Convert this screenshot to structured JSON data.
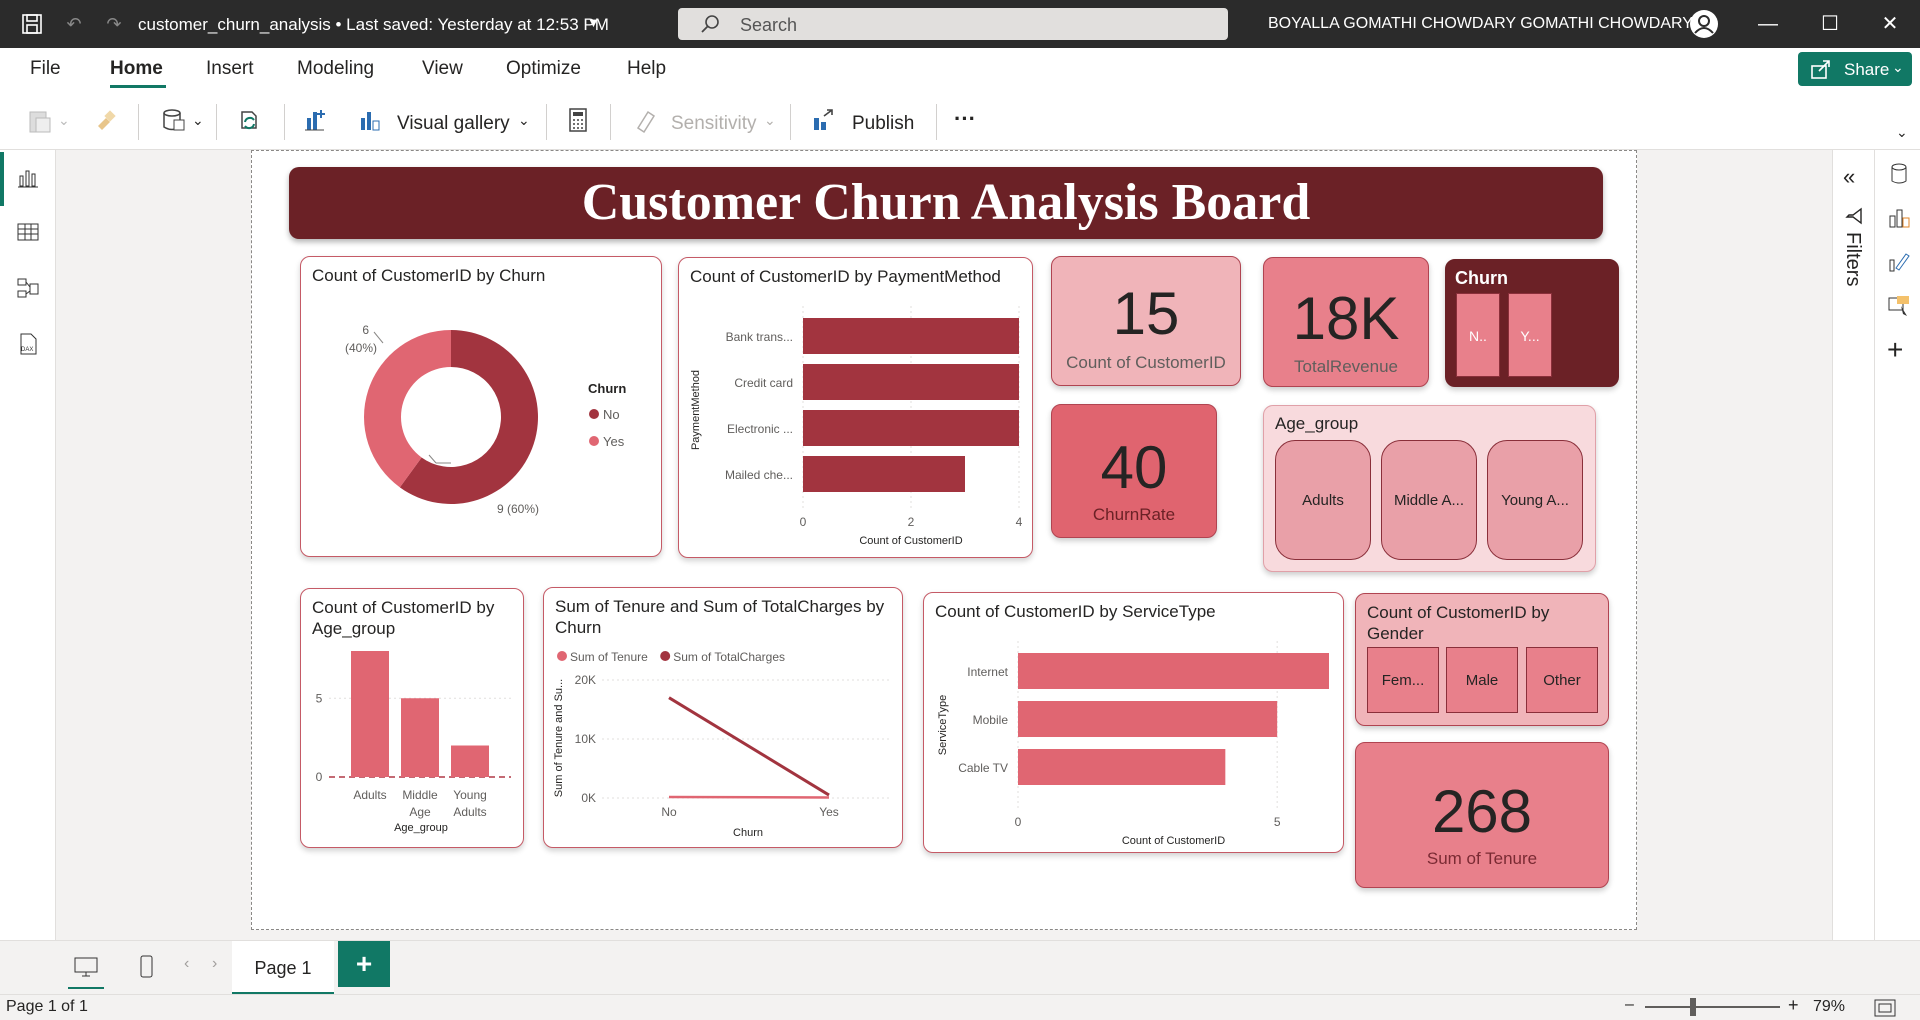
{
  "titlebar": {
    "file_title": "customer_churn_analysis • Last saved: Yesterday at 12:53 PM",
    "search_placeholder": "Search",
    "user_name": "BOYALLA GOMATHI CHOWDARY GOMATHI CHOWDARY"
  },
  "menu": {
    "items": [
      "File",
      "Home",
      "Insert",
      "Modeling",
      "View",
      "Optimize",
      "Help"
    ],
    "active": "Home",
    "share_label": "Share"
  },
  "ribbon": {
    "visual_gallery": "Visual gallery",
    "sensitivity": "Sensitivity",
    "publish": "Publish",
    "more": "···"
  },
  "filters_label": "Filters",
  "page_tabs": {
    "page1": "Page 1",
    "add": "+"
  },
  "status": {
    "page_info": "Page 1 of 1",
    "zoom": "79%"
  },
  "report": {
    "title": "Customer Churn Analysis Board",
    "churn_donut": {
      "title": "Count of CustomerID by Churn",
      "legend_title": "Churn",
      "label_yes_value": "6",
      "label_yes_pct": "(40%)",
      "label_no": "9 (60%)"
    },
    "kpis": {
      "count_value": "15",
      "count_label": "Count of CustomerID",
      "revenue_value": "18K",
      "revenue_label": "TotalRevenue",
      "churnrate_value": "40",
      "churnrate_label": "ChurnRate",
      "tenure_value": "268",
      "tenure_label": "Sum of Tenure"
    },
    "churn_slicer": {
      "title": "Churn",
      "options": [
        "N..",
        "Y..."
      ]
    },
    "age_slicer": {
      "title": "Age_group",
      "options": [
        "Adults",
        "Middle A...",
        "Young A..."
      ]
    },
    "gender_slicer": {
      "title": "Count of CustomerID by Gender",
      "options": [
        "Fem...",
        "Male",
        "Other"
      ]
    },
    "payment_title": "Count of CustomerID by PaymentMethod",
    "age_title": "Count of CustomerID by Age_group",
    "tenure_title": "Sum of Tenure and Sum of TotalCharges by Churn",
    "service_title": "Count of CustomerID by ServiceType"
  },
  "colors": {
    "dark_red": "#a2343f",
    "light_red": "#e06672",
    "banner": "#6b2126",
    "kpi_pink": "#f0b4b9",
    "kpi_mid": "#e8808b",
    "kpi_dark": "#e0646f",
    "accent_green": "#117865"
  },
  "chart_data": [
    {
      "type": "pie",
      "title": "Count of CustomerID by Churn",
      "categories": [
        "No",
        "Yes"
      ],
      "values": [
        9,
        6
      ],
      "legend_title": "Churn",
      "colors": [
        "#a2343f",
        "#e06672"
      ]
    },
    {
      "type": "bar",
      "orientation": "horizontal",
      "title": "Count of CustomerID by PaymentMethod",
      "categories": [
        "Bank trans...",
        "Credit card",
        "Electronic ...",
        "Mailed che..."
      ],
      "values": [
        4,
        4,
        4,
        3
      ],
      "xlabel": "Count of CustomerID",
      "ylabel": "PaymentMethod",
      "xticks": [
        "0",
        "2",
        "4"
      ],
      "xlim": [
        0,
        4
      ]
    },
    {
      "type": "bar",
      "title": "Count of CustomerID by Age_group",
      "categories": [
        "Adults",
        "Middle Age",
        "Young Adults"
      ],
      "values": [
        8,
        5,
        2
      ],
      "xlabel": "Age_group",
      "yticks": [
        "5",
        "0"
      ],
      "ylim": [
        0,
        8
      ]
    },
    {
      "type": "line",
      "title": "Sum of Tenure and Sum of TotalCharges by Churn",
      "x": [
        "No",
        "Yes"
      ],
      "series": [
        {
          "name": "Sum of Tenure",
          "values": [
            180,
            88
          ]
        },
        {
          "name": "Sum of TotalCharges",
          "values": [
            17000,
            500
          ]
        }
      ],
      "xlabel": "Churn",
      "ylabel": "Sum of Tenure and Su...",
      "yticks": [
        "20K",
        "10K",
        "0K"
      ],
      "ylim": [
        0,
        20000
      ]
    },
    {
      "type": "bar",
      "orientation": "horizontal",
      "title": "Count of CustomerID by ServiceType",
      "categories": [
        "Internet",
        "Mobile",
        "Cable TV"
      ],
      "values": [
        6,
        5,
        4
      ],
      "xlabel": "Count of CustomerID",
      "ylabel": "ServiceType",
      "xticks": [
        "0",
        "5"
      ],
      "xlim": [
        0,
        6
      ]
    }
  ]
}
